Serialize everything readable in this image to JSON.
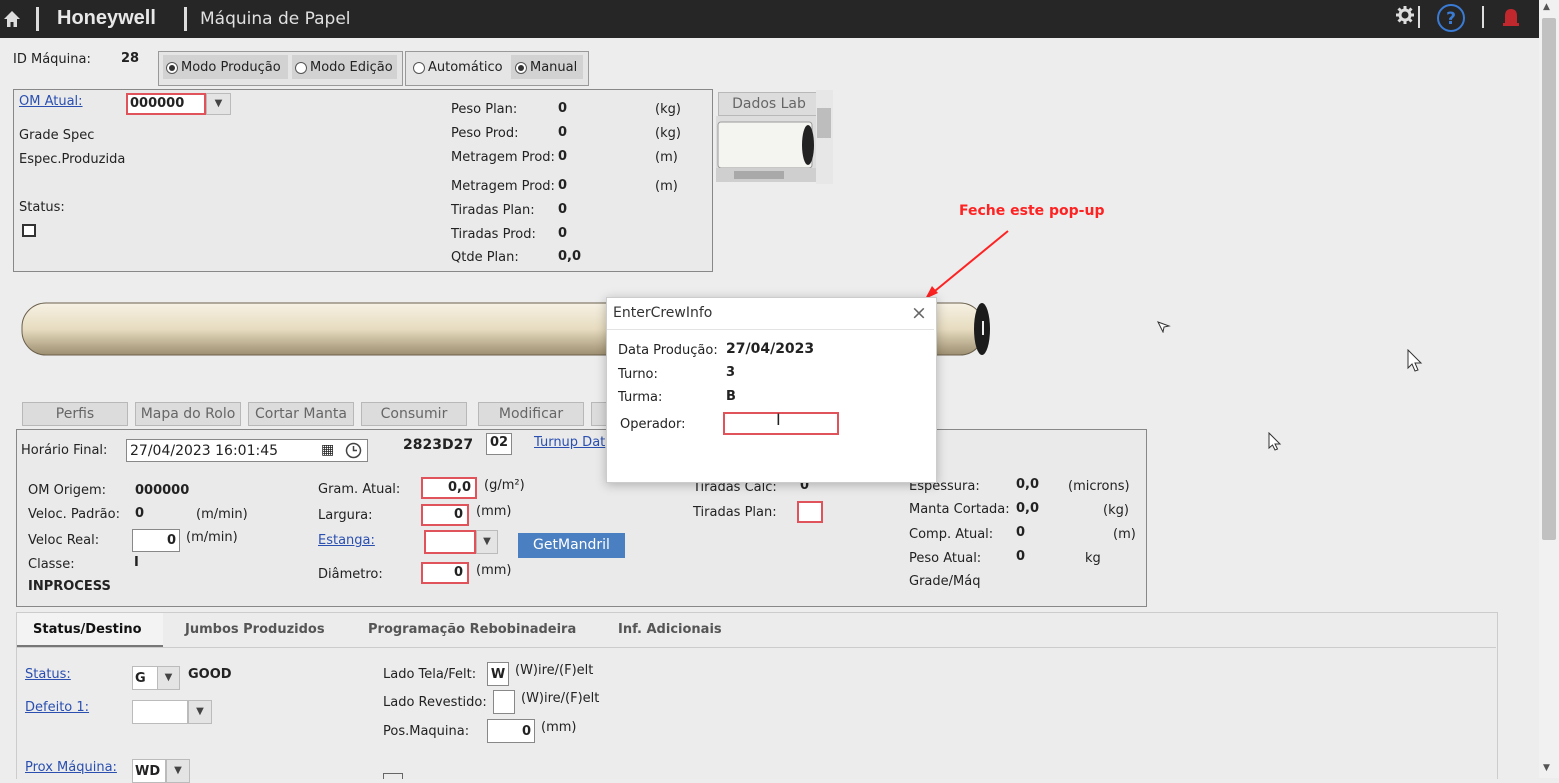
{
  "header": {
    "brand": "Honeywell",
    "title": "Máquina de Papel"
  },
  "machine": {
    "id_label": "ID Máquina:",
    "id_value": "28",
    "mode_production": "Modo Produção",
    "mode_edit": "Modo Edição",
    "auto": "Automático",
    "manual": "Manual"
  },
  "om": {
    "label": "OM Atual:",
    "value": "000000",
    "grade_spec": "Grade Spec",
    "espec": "Espec.Produzida",
    "status": "Status:"
  },
  "weights": [
    {
      "label": "Peso Plan:",
      "value": "0",
      "unit": "(kg)"
    },
    {
      "label": "Peso Prod:",
      "value": "0",
      "unit": "(kg)"
    },
    {
      "label": "Metragem Prod:",
      "value": "0",
      "unit": "(m)"
    },
    {
      "label": "Metragem Prod:",
      "value": "0",
      "unit": "(m)"
    },
    {
      "label": "Tiradas Plan:",
      "value": "0",
      "unit": ""
    },
    {
      "label": "Tiradas Prod:",
      "value": "0",
      "unit": ""
    },
    {
      "label": "Qtde Plan:",
      "value": "0,0",
      "unit": ""
    }
  ],
  "dados_lab": "Dados Lab",
  "annotation": "Feche este pop-up",
  "toolbar": [
    "Perfis",
    "Mapa do Rolo",
    "Cortar Manta",
    "Consumir",
    "Modificar"
  ],
  "details": {
    "horario_label": "Horário Final:",
    "horario_value": "27/04/2023 16:01:45",
    "code": "2823D27",
    "code_box": "02",
    "turnup": "Turnup Dat",
    "om_origem_label": "OM Origem:",
    "om_origem_value": "000000",
    "veloc_padrao_label": "Veloc. Padrão:",
    "veloc_padrao_value": "0",
    "veloc_unit": "(m/min)",
    "veloc_real_label": "Veloc Real:",
    "veloc_real_value": "0",
    "classe_label": "Classe:",
    "classe_value": "I",
    "inprocess": "INPROCESS",
    "gram_label": "Gram. Atual:",
    "gram_value": "0,0",
    "gram_unit": "(g/m²)",
    "largura_label": "Largura:",
    "largura_value": "0",
    "mm": "(mm)",
    "estanga": "Estanga:",
    "diametro_label": "Diâmetro:",
    "diametro_value": "0",
    "getmandril": "GetMandril",
    "tiradas_calc": "Tiradas Calc:",
    "tiradas_calc_value": "0",
    "tiradas_plan": "Tiradas Plan:",
    "espessura_label": "Espessura:",
    "espessura_value": "0,0",
    "espessura_unit": "(microns)",
    "manta_label": "Manta Cortada:",
    "manta_value": "0,0",
    "manta_unit": "(kg)",
    "comp_label": "Comp. Atual:",
    "comp_value": "0",
    "comp_unit": "(m)",
    "peso_label": "Peso Atual:",
    "peso_value": "0",
    "peso_unit": "kg",
    "grade_maq": "Grade/Máq"
  },
  "tabs": [
    "Status/Destino",
    "Jumbos Produzidos",
    "Programação Rebobinadeira",
    "Inf. Adicionais"
  ],
  "status_tab": {
    "status_label": "Status:",
    "status_code": "G",
    "status_text": "GOOD",
    "defeito": "Defeito 1:",
    "prox": "Prox Máquina:",
    "prox_value": "WD",
    "lado_tela": "Lado Tela/Felt:",
    "lado_tela_value": "W",
    "wire_felt": "(W)ire/(F)elt",
    "lado_rev": "Lado Revestido:",
    "pos_maquina": "Pos.Maquina:",
    "pos_value": "0",
    "mm": "(mm)"
  },
  "modal": {
    "title": "EnterCrewInfo",
    "close": "×",
    "data_label": "Data Produção:",
    "data_value": "27/04/2023",
    "turno_label": "Turno:",
    "turno_value": "3",
    "turma_label": "Turma:",
    "turma_value": "B",
    "operador_label": "Operador:",
    "operador_value": ""
  }
}
